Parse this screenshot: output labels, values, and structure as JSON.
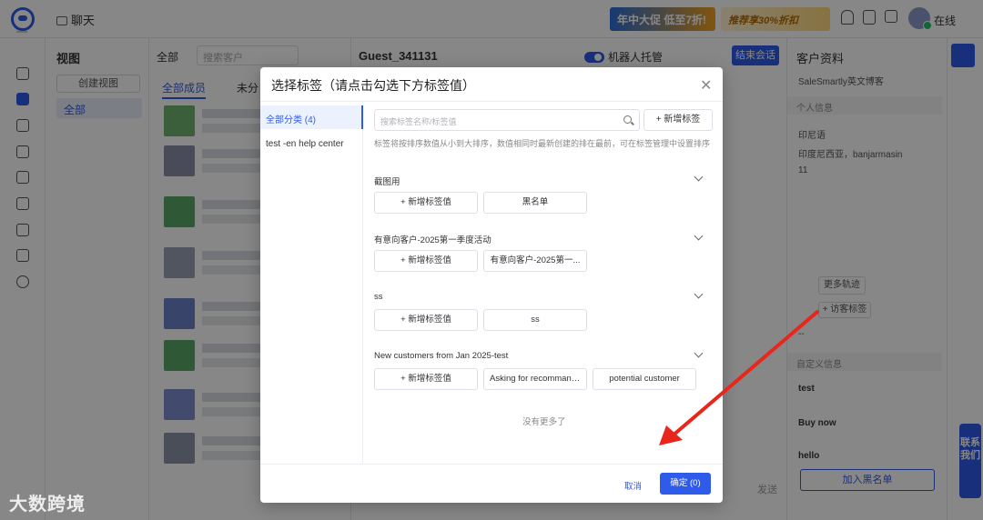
{
  "app": {
    "chat_tab": "聊天",
    "promo_1": "年中大促 低至7折!",
    "promo_2": "推荐享30%折扣",
    "online_status": "在线"
  },
  "view_panel": {
    "title": "视图",
    "create_view": "创建视图",
    "all": "全部"
  },
  "list_panel": {
    "scope": "全部",
    "search_placeholder": "搜索客户",
    "tab_all_members": "全部成员",
    "tab_unassigned": "未分"
  },
  "chat": {
    "guest_name": "Guest_341131",
    "robot_hosting": "机器人托管",
    "end_session": "结束会话",
    "send": "发送"
  },
  "profile": {
    "title": "客户资料",
    "blog": "SaleSmartly英文博客",
    "personal_info": "个人信息",
    "country": "印尼语",
    "location": "印度尼西亚，banjarmasin",
    "phone": "11",
    "more_tracks": "更多轨迹",
    "visitor_tag": "+ 访客标签",
    "dash": "--",
    "custom_info": "自定义信息",
    "field_test": "test",
    "field_buy_now": "Buy now",
    "field_hello": "hello",
    "add_blacklist": "加入黑名单",
    "contact_us": "联系我们"
  },
  "modal": {
    "title": "选择标签（请点击勾选下方标签值）",
    "categories": [
      {
        "label": "全部分类 (4)",
        "active": true
      },
      {
        "label": "test -en help center",
        "active": false
      }
    ],
    "search_placeholder": "搜索标签名称/标签值",
    "add_tag": "+ 新增标签",
    "hint": "标签将按排序数值从小到大排序，数值相同时最新创建的排在最前，可在标签管理中设置排序",
    "add_tag_value": "+ 新增标签值",
    "groups": [
      {
        "title": "截图用",
        "values": [
          "黑名单"
        ]
      },
      {
        "title": "有意向客户-2025第一季度活动",
        "values": [
          "有意向客户-2025第一..."
        ]
      },
      {
        "title": "ss",
        "values": [
          "ss"
        ]
      },
      {
        "title": "New customers from Jan 2025-test",
        "values": [
          "Asking for recommand...",
          "potential customer"
        ]
      }
    ],
    "no_more": "没有更多了",
    "cancel": "取消",
    "confirm": "确定 (0)"
  },
  "watermark": "大数跨境",
  "colors": {
    "accent": "#2f5bea",
    "arrow": "#e8261c"
  }
}
